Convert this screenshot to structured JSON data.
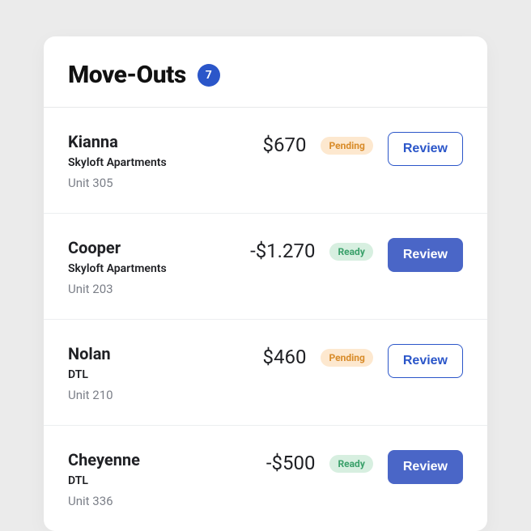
{
  "header": {
    "title": "Move-Outs",
    "count": "7"
  },
  "moveouts": [
    {
      "name": "Kianna",
      "property": "Skyloft Apartments",
      "unit": "Unit 305",
      "amount": "$670",
      "status_label": "Pending",
      "status_kind": "pending",
      "button_label": "Review",
      "button_style": "outlined"
    },
    {
      "name": "Cooper",
      "property": "Skyloft Apartments",
      "unit": "Unit 203",
      "amount": "-$1.270",
      "status_label": "Ready",
      "status_kind": "ready",
      "button_label": "Review",
      "button_style": "filled"
    },
    {
      "name": "Nolan",
      "property": "DTL",
      "unit": "Unit  210",
      "amount": "$460",
      "status_label": "Pending",
      "status_kind": "pending",
      "button_label": "Review",
      "button_style": "outlined"
    },
    {
      "name": "Cheyenne",
      "property": "DTL",
      "unit": "Unit 336",
      "amount": "-$500",
      "status_label": "Ready",
      "status_kind": "ready",
      "button_label": "Review",
      "button_style": "filled"
    }
  ]
}
